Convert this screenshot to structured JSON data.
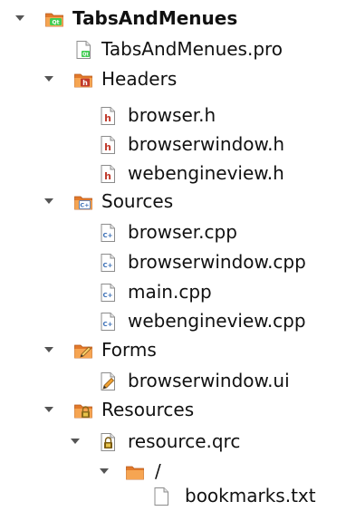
{
  "tree": {
    "project": {
      "name": "TabsAndMenues",
      "expanded": true,
      "icon": "qt-project-folder-icon",
      "children": {
        "pro_file": {
          "name": "TabsAndMenues.pro",
          "icon": "qt-project-file-icon"
        },
        "headers": {
          "name": "Headers",
          "expanded": true,
          "icon": "headers-folder-icon",
          "files": [
            {
              "name": "browser.h",
              "icon": "header-file-icon"
            },
            {
              "name": "browserwindow.h",
              "icon": "header-file-icon"
            },
            {
              "name": "webengineview.h",
              "icon": "header-file-icon"
            }
          ]
        },
        "sources": {
          "name": "Sources",
          "expanded": true,
          "icon": "sources-folder-icon",
          "files": [
            {
              "name": "browser.cpp",
              "icon": "cpp-file-icon"
            },
            {
              "name": "browserwindow.cpp",
              "icon": "cpp-file-icon"
            },
            {
              "name": "main.cpp",
              "icon": "cpp-file-icon"
            },
            {
              "name": "webengineview.cpp",
              "icon": "cpp-file-icon"
            }
          ]
        },
        "forms": {
          "name": "Forms",
          "expanded": true,
          "icon": "forms-folder-icon",
          "files": [
            {
              "name": "browserwindow.ui",
              "icon": "ui-file-icon"
            }
          ]
        },
        "resources": {
          "name": "Resources",
          "expanded": true,
          "icon": "resources-folder-icon",
          "qrc": {
            "name": "resource.qrc",
            "expanded": true,
            "icon": "qrc-file-icon",
            "prefix": {
              "name": "/",
              "expanded": true,
              "icon": "folder-icon",
              "files": [
                {
                  "name": "bookmarks.txt",
                  "icon": "text-file-icon"
                }
              ]
            }
          }
        }
      }
    }
  },
  "colors": {
    "qt_green": "#41cd52",
    "header_red": "#c0392b",
    "cpp_blue": "#3b6fb6",
    "folder_orange": "#f0913a",
    "text": "#111111"
  }
}
